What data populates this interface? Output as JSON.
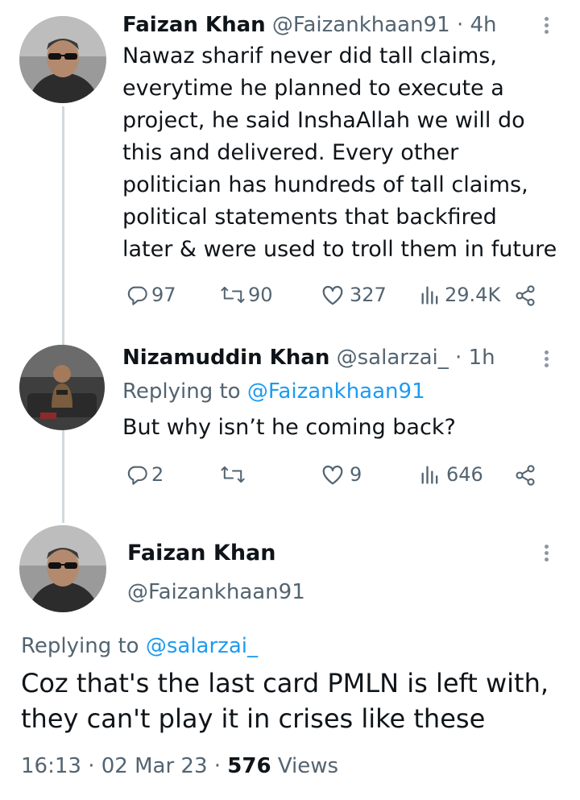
{
  "tweet1": {
    "name": "Faizan Khan",
    "handle": "@Faizankhaan91",
    "sep": "·",
    "time": "4h",
    "lines": [
      "Nawaz sharif never did tall claims,",
      "everytime he planned to execute a",
      "project, he said InshaAllah we will do",
      "this and delivered. Every other",
      "politician has hundreds of tall claims,",
      "political statements that backfired",
      "later & were used to troll them in future"
    ],
    "replies": "97",
    "retweets": "90",
    "likes": "327",
    "views": "29.4K"
  },
  "tweet2": {
    "name": "Nizamuddin Khan",
    "handle": "@salarzai_",
    "sep": "·",
    "time": "1h",
    "replying_prefix": "Replying to",
    "replying_to": "@Faizankhaan91",
    "text": "But why isn’t he coming back?",
    "replies": "2",
    "retweets": "",
    "likes": "9",
    "views": "646"
  },
  "tweet3": {
    "name": "Faizan Khan",
    "handle": "@Faizankhaan91",
    "replying_prefix": "Replying to",
    "replying_to": "@salarzai_",
    "lines": [
      "Coz that's the last card PMLN is left with,",
      "they can't play it in crises like these"
    ],
    "time": "16:13",
    "date": "02 Mar 23",
    "sep1": "·",
    "sep2": "·",
    "views_count": "576",
    "views_label": "Views"
  },
  "icons": {
    "reply": "reply-icon",
    "retweet": "retweet-icon",
    "like": "heart-icon",
    "views": "views-icon",
    "share": "share-icon",
    "more": "more-icon"
  },
  "colors": {
    "text": "#0f1419",
    "muted": "#536471",
    "link": "#1d9bf0",
    "thread_line": "#cfd9de"
  }
}
